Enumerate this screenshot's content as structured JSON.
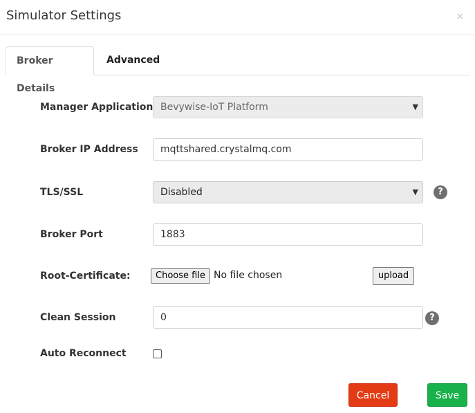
{
  "modal": {
    "title": "Simulator Settings",
    "close_symbol": "×"
  },
  "tabs": [
    {
      "label": "Broker Details",
      "active": true
    },
    {
      "label": "Advanced",
      "active": false
    }
  ],
  "form": {
    "manager_applications": {
      "label": "Manager Applications",
      "value": "Bevywise-IoT Platform"
    },
    "broker_ip": {
      "label": "Broker IP Address",
      "value": "mqttshared.crystalmq.com"
    },
    "tls_ssl": {
      "label": "TLS/SSL",
      "value": "Disabled",
      "help": "?"
    },
    "broker_port": {
      "label": "Broker Port",
      "value": "1883"
    },
    "root_certificate": {
      "label": "Root-Certificate:",
      "choose_label": "Choose file",
      "status": "No file chosen",
      "upload_label": "upload"
    },
    "clean_session": {
      "label": "Clean Session",
      "value": "0",
      "help": "?"
    },
    "auto_reconnect": {
      "label": "Auto Reconnect",
      "checked": false
    }
  },
  "footer": {
    "cancel_label": "Cancel",
    "save_label": "Save"
  },
  "colors": {
    "cancel": "#e33b14",
    "save": "#18b14a",
    "help_icon": "#6f6f6f"
  }
}
